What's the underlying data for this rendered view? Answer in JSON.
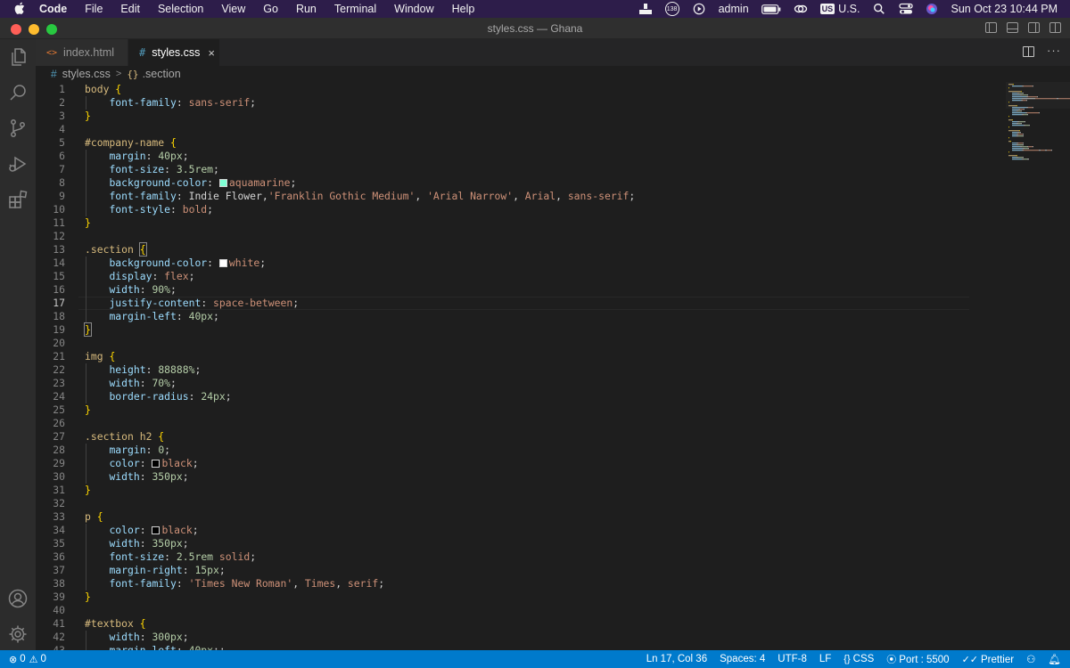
{
  "menubar": {
    "app_name": "Code",
    "items": [
      "File",
      "Edit",
      "Selection",
      "View",
      "Go",
      "Run",
      "Terminal",
      "Window",
      "Help"
    ],
    "tray": {
      "badge_count": "138",
      "user": "admin",
      "input_source_badge": "US",
      "input_source_label": "U.S.",
      "datetime": "Sun Oct 23  10:44 PM"
    }
  },
  "window": {
    "title": "styles.css — Ghana",
    "traffic_light_colors": [
      "#ff5f57",
      "#febc2e",
      "#28c840"
    ]
  },
  "tabs": [
    {
      "icon": "<>",
      "label": "index.html",
      "active": false
    },
    {
      "icon": "#",
      "label": "styles.css",
      "active": true,
      "close": "×"
    }
  ],
  "breadcrumb": {
    "file_icon": "#",
    "file": "styles.css",
    "separator": ">",
    "symbol_icon": "{}",
    "symbol": ".section"
  },
  "editor": {
    "current_line": 17,
    "lines": [
      {
        "n": 1,
        "indent": 0,
        "tokens": [
          [
            "sel",
            "body "
          ],
          [
            "brace",
            "{"
          ]
        ]
      },
      {
        "n": 2,
        "indent": 1,
        "tokens": [
          [
            "prop",
            "font-family"
          ],
          [
            "punc",
            ": "
          ],
          [
            "str",
            "sans-serif"
          ],
          [
            "punc",
            ";"
          ]
        ]
      },
      {
        "n": 3,
        "indent": 0,
        "tokens": [
          [
            "brace",
            "}"
          ]
        ]
      },
      {
        "n": 4,
        "indent": 0,
        "tokens": []
      },
      {
        "n": 5,
        "indent": 0,
        "tokens": [
          [
            "sel",
            "#company-name "
          ],
          [
            "brace",
            "{"
          ]
        ]
      },
      {
        "n": 6,
        "indent": 1,
        "tokens": [
          [
            "prop",
            "margin"
          ],
          [
            "punc",
            ": "
          ],
          [
            "num",
            "40px"
          ],
          [
            "punc",
            ";"
          ]
        ]
      },
      {
        "n": 7,
        "indent": 1,
        "tokens": [
          [
            "prop",
            "font-size"
          ],
          [
            "punc",
            ": "
          ],
          [
            "num",
            "3.5rem"
          ],
          [
            "punc",
            ";"
          ]
        ]
      },
      {
        "n": 8,
        "indent": 1,
        "tokens": [
          [
            "prop",
            "background-color"
          ],
          [
            "punc",
            ": "
          ],
          [
            "swatch",
            "#7fffd4"
          ],
          [
            "str",
            "aquamarine"
          ],
          [
            "punc",
            ";"
          ]
        ]
      },
      {
        "n": 9,
        "indent": 1,
        "tokens": [
          [
            "prop",
            "font-family"
          ],
          [
            "punc",
            ": Indie Flower,"
          ],
          [
            "str",
            "'Franklin Gothic Medium'"
          ],
          [
            "punc",
            ", "
          ],
          [
            "str",
            "'Arial Narrow'"
          ],
          [
            "punc",
            ", "
          ],
          [
            "str",
            "Arial"
          ],
          [
            "punc",
            ", "
          ],
          [
            "str",
            "sans-serif"
          ],
          [
            "punc",
            ";"
          ]
        ]
      },
      {
        "n": 10,
        "indent": 1,
        "tokens": [
          [
            "prop",
            "font-style"
          ],
          [
            "punc",
            ": "
          ],
          [
            "str",
            "bold"
          ],
          [
            "punc",
            ";"
          ]
        ]
      },
      {
        "n": 11,
        "indent": 0,
        "tokens": [
          [
            "brace",
            "}"
          ]
        ]
      },
      {
        "n": 12,
        "indent": 0,
        "tokens": []
      },
      {
        "n": 13,
        "indent": 0,
        "tokens": [
          [
            "sel",
            ".section "
          ],
          [
            "match",
            "{"
          ]
        ]
      },
      {
        "n": 14,
        "indent": 1,
        "tokens": [
          [
            "prop",
            "background-color"
          ],
          [
            "punc",
            ": "
          ],
          [
            "swatch",
            "#ffffff"
          ],
          [
            "str",
            "white"
          ],
          [
            "punc",
            ";"
          ]
        ]
      },
      {
        "n": 15,
        "indent": 1,
        "tokens": [
          [
            "prop",
            "display"
          ],
          [
            "punc",
            ": "
          ],
          [
            "str",
            "flex"
          ],
          [
            "punc",
            ";"
          ]
        ]
      },
      {
        "n": 16,
        "indent": 1,
        "tokens": [
          [
            "prop",
            "width"
          ],
          [
            "punc",
            ": "
          ],
          [
            "num",
            "90%"
          ],
          [
            "punc",
            ";"
          ]
        ]
      },
      {
        "n": 17,
        "indent": 1,
        "tokens": [
          [
            "prop",
            "justify-content"
          ],
          [
            "punc",
            ": "
          ],
          [
            "str",
            "space-between"
          ],
          [
            "punc",
            ";"
          ]
        ]
      },
      {
        "n": 18,
        "indent": 1,
        "tokens": [
          [
            "prop",
            "margin-left"
          ],
          [
            "punc",
            ": "
          ],
          [
            "num",
            "40px"
          ],
          [
            "punc",
            ";"
          ]
        ]
      },
      {
        "n": 19,
        "indent": 0,
        "tokens": [
          [
            "match",
            "}"
          ]
        ]
      },
      {
        "n": 20,
        "indent": 0,
        "tokens": []
      },
      {
        "n": 21,
        "indent": 0,
        "tokens": [
          [
            "sel",
            "img "
          ],
          [
            "brace",
            "{"
          ]
        ]
      },
      {
        "n": 22,
        "indent": 1,
        "tokens": [
          [
            "prop",
            "height"
          ],
          [
            "punc",
            ": "
          ],
          [
            "num",
            "88888%"
          ],
          [
            "punc",
            ";"
          ]
        ]
      },
      {
        "n": 23,
        "indent": 1,
        "tokens": [
          [
            "prop",
            "width"
          ],
          [
            "punc",
            ": "
          ],
          [
            "num",
            "70%"
          ],
          [
            "punc",
            ";"
          ]
        ]
      },
      {
        "n": 24,
        "indent": 1,
        "tokens": [
          [
            "prop",
            "border-radius"
          ],
          [
            "punc",
            ": "
          ],
          [
            "num",
            "24px"
          ],
          [
            "punc",
            ";"
          ]
        ]
      },
      {
        "n": 25,
        "indent": 0,
        "tokens": [
          [
            "brace",
            "}"
          ]
        ]
      },
      {
        "n": 26,
        "indent": 0,
        "tokens": []
      },
      {
        "n": 27,
        "indent": 0,
        "tokens": [
          [
            "sel",
            ".section h2 "
          ],
          [
            "brace",
            "{"
          ]
        ]
      },
      {
        "n": 28,
        "indent": 1,
        "tokens": [
          [
            "prop",
            "margin"
          ],
          [
            "punc",
            ": "
          ],
          [
            "num",
            "0"
          ],
          [
            "punc",
            ";"
          ]
        ]
      },
      {
        "n": 29,
        "indent": 1,
        "tokens": [
          [
            "prop",
            "color"
          ],
          [
            "punc",
            ": "
          ],
          [
            "swatch",
            "#000000"
          ],
          [
            "str",
            "black"
          ],
          [
            "punc",
            ";"
          ]
        ]
      },
      {
        "n": 30,
        "indent": 1,
        "tokens": [
          [
            "prop",
            "width"
          ],
          [
            "punc",
            ": "
          ],
          [
            "num",
            "350px"
          ],
          [
            "punc",
            ";"
          ]
        ]
      },
      {
        "n": 31,
        "indent": 0,
        "tokens": [
          [
            "brace",
            "}"
          ]
        ]
      },
      {
        "n": 32,
        "indent": 0,
        "tokens": []
      },
      {
        "n": 33,
        "indent": 0,
        "tokens": [
          [
            "sel",
            "p "
          ],
          [
            "brace",
            "{"
          ]
        ]
      },
      {
        "n": 34,
        "indent": 1,
        "tokens": [
          [
            "prop",
            "color"
          ],
          [
            "punc",
            ": "
          ],
          [
            "swatch",
            "#000000"
          ],
          [
            "str",
            "black"
          ],
          [
            "punc",
            ";"
          ]
        ]
      },
      {
        "n": 35,
        "indent": 1,
        "tokens": [
          [
            "prop",
            "width"
          ],
          [
            "punc",
            ": "
          ],
          [
            "num",
            "350px"
          ],
          [
            "punc",
            ";"
          ]
        ]
      },
      {
        "n": 36,
        "indent": 1,
        "tokens": [
          [
            "prop",
            "font-size"
          ],
          [
            "punc",
            ": "
          ],
          [
            "num",
            "2.5rem"
          ],
          [
            "punc",
            " "
          ],
          [
            "str",
            "solid"
          ],
          [
            "punc",
            ";"
          ]
        ]
      },
      {
        "n": 37,
        "indent": 1,
        "tokens": [
          [
            "prop",
            "margin-right"
          ],
          [
            "punc",
            ": "
          ],
          [
            "num",
            "15px"
          ],
          [
            "punc",
            ";"
          ]
        ]
      },
      {
        "n": 38,
        "indent": 1,
        "tokens": [
          [
            "prop",
            "font-family"
          ],
          [
            "punc",
            ": "
          ],
          [
            "str",
            "'Times New Roman'"
          ],
          [
            "punc",
            ", "
          ],
          [
            "str",
            "Times"
          ],
          [
            "punc",
            ", "
          ],
          [
            "str",
            "serif"
          ],
          [
            "punc",
            ";"
          ]
        ]
      },
      {
        "n": 39,
        "indent": 0,
        "tokens": [
          [
            "brace",
            "}"
          ]
        ]
      },
      {
        "n": 40,
        "indent": 0,
        "tokens": []
      },
      {
        "n": 41,
        "indent": 0,
        "tokens": [
          [
            "sel",
            "#textbox "
          ],
          [
            "brace",
            "{"
          ]
        ]
      },
      {
        "n": 42,
        "indent": 1,
        "tokens": [
          [
            "prop",
            "width"
          ],
          [
            "punc",
            ": "
          ],
          [
            "num",
            "300px"
          ],
          [
            "punc",
            ";"
          ]
        ]
      },
      {
        "n": 43,
        "indent": 1,
        "tokens": [
          [
            "prop",
            "margin-left"
          ],
          [
            "punc",
            ": "
          ],
          [
            "num",
            "40px"
          ],
          [
            "punc",
            ";;"
          ]
        ]
      }
    ]
  },
  "statusbar": {
    "errors": "0",
    "warnings": "0",
    "position": "Ln 17, Col 36",
    "spaces": "Spaces: 4",
    "encoding": "UTF-8",
    "eol": "LF",
    "language": "CSS",
    "port": "Port : 5500",
    "formatter": "Prettier"
  },
  "colors": {
    "menubar_bg": "#2d1d4a",
    "editor_bg": "#1e1e1e",
    "status_bg": "#007acc",
    "selector": "#d7ba7d",
    "property": "#9cdcfe",
    "string_value": "#ce9178",
    "number_value": "#b5cea8"
  }
}
